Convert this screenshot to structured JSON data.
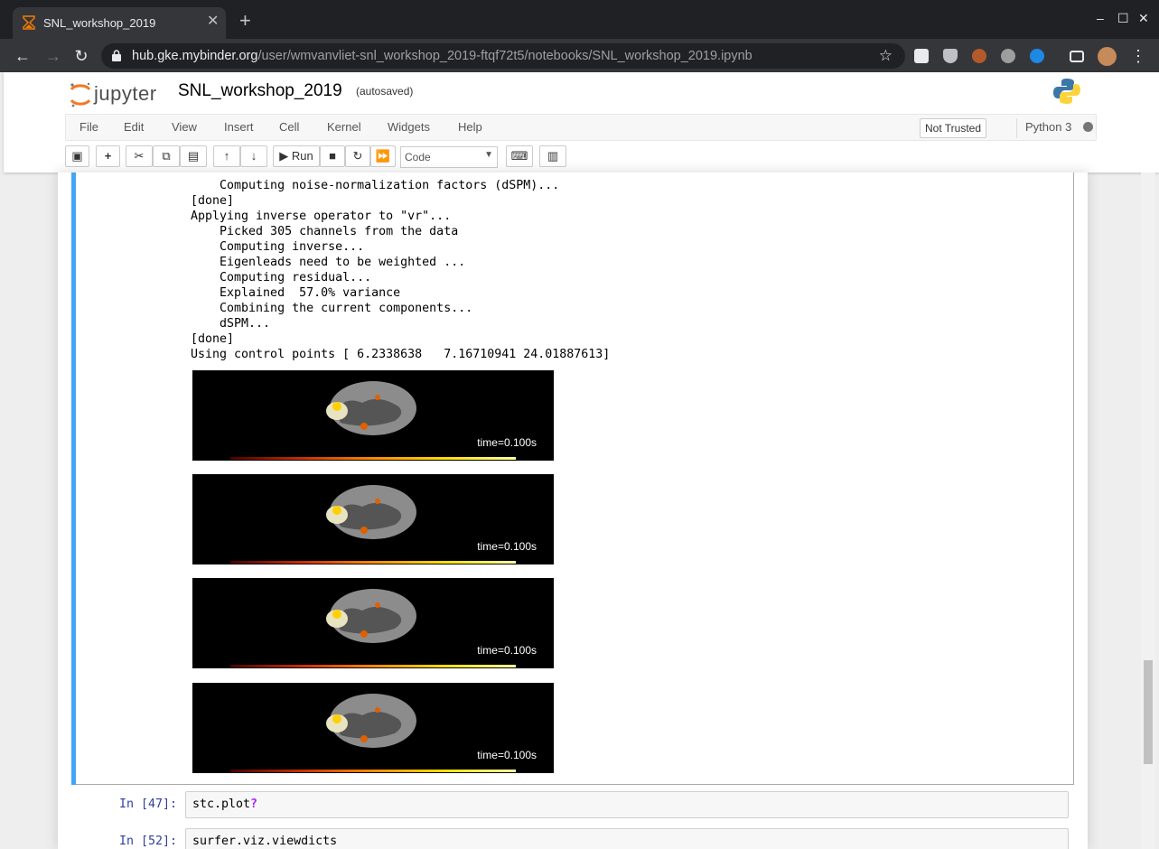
{
  "browser": {
    "tab_title": "SNL_workshop_2019",
    "close_glyph": "✕",
    "new_tab_glyph": "+",
    "url_host": "hub.gke.mybinder.org",
    "url_path": "/user/wmvanvliet-snl_workshop_2019-ftqf72t5/notebooks/SNL_workshop_2019.ipynb",
    "minimize": "–",
    "maximize": "☐",
    "close": "✕"
  },
  "jupyter": {
    "logo_text": "jupyter",
    "notebook_name": "SNL_workshop_2019",
    "save_status": "(autosaved)",
    "menus": [
      "File",
      "Edit",
      "View",
      "Insert",
      "Cell",
      "Kernel",
      "Widgets",
      "Help"
    ],
    "trusted_label": "Not Trusted",
    "kernel_name": "Python 3",
    "run_label": "Run",
    "cell_type": "Code"
  },
  "output_text": "    Computing noise-normalization factors (dSPM)...\n[done]\nApplying inverse operator to \"vr\"...\n    Picked 305 channels from the data\n    Computing inverse...\n    Eigenleads need to be weighted ...\n    Computing residual...\n    Explained  57.0% variance\n    Combining the current components...\n    dSPM...\n[done]\nUsing control points [ 6.2338638   7.16710941 24.01887613]",
  "figures": [
    {
      "time_label": "time=0.100s"
    },
    {
      "time_label": "time=0.100s"
    },
    {
      "time_label": "time=0.100s"
    },
    {
      "time_label": "time=0.100s"
    }
  ],
  "cells": [
    {
      "prompt": "In [47]:",
      "code_obj": "stc.plot",
      "code_q": "?"
    },
    {
      "prompt": "In [52]:",
      "code": "surfer.viz.viewdicts"
    }
  ],
  "colors": {
    "accent": "#42a5f5",
    "prompt": "#303f9f",
    "question": "#aa22ff"
  }
}
